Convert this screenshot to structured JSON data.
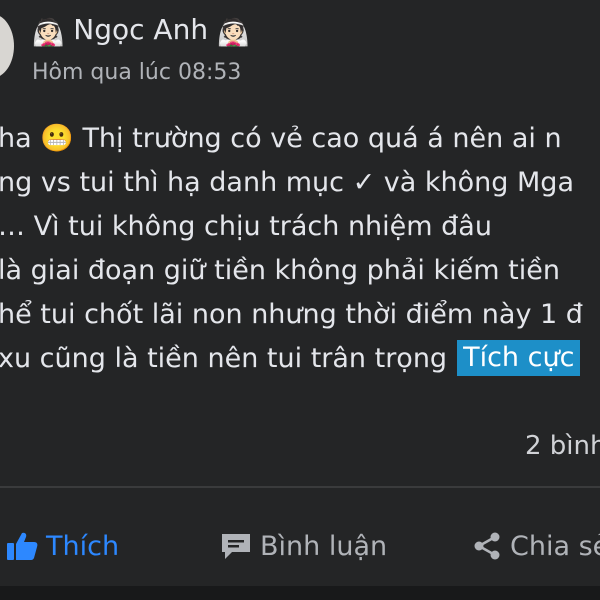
{
  "post": {
    "author": "Ngọc Anh",
    "author_emoji": "👰🏻",
    "timestamp": "Hôm qua lúc 08:53",
    "lines": [
      "ha 😬 Thị trường có vẻ cao quá á nên ai n",
      "ng vs tui thì hạ danh mục ✓ và không Mga",
      "… Vì tui không chịu trách nhiệm đâu",
      "là giai đoạn giữ tiền không phải kiếm tiền",
      "hể tui chốt lãi non nhưng thời điểm này 1 đ",
      "xu cũng là tiền nên tui trân trọng"
    ],
    "tag": "Tích cực",
    "comment_count": "2 bình"
  },
  "actions": {
    "like": "Thích",
    "comment": "Bình luận",
    "share": "Chia sẻ"
  },
  "colors": {
    "background": "#242526",
    "like_active": "#2d88ff",
    "tag_bg": "#1d8fc8",
    "muted": "#b0b3b8"
  }
}
